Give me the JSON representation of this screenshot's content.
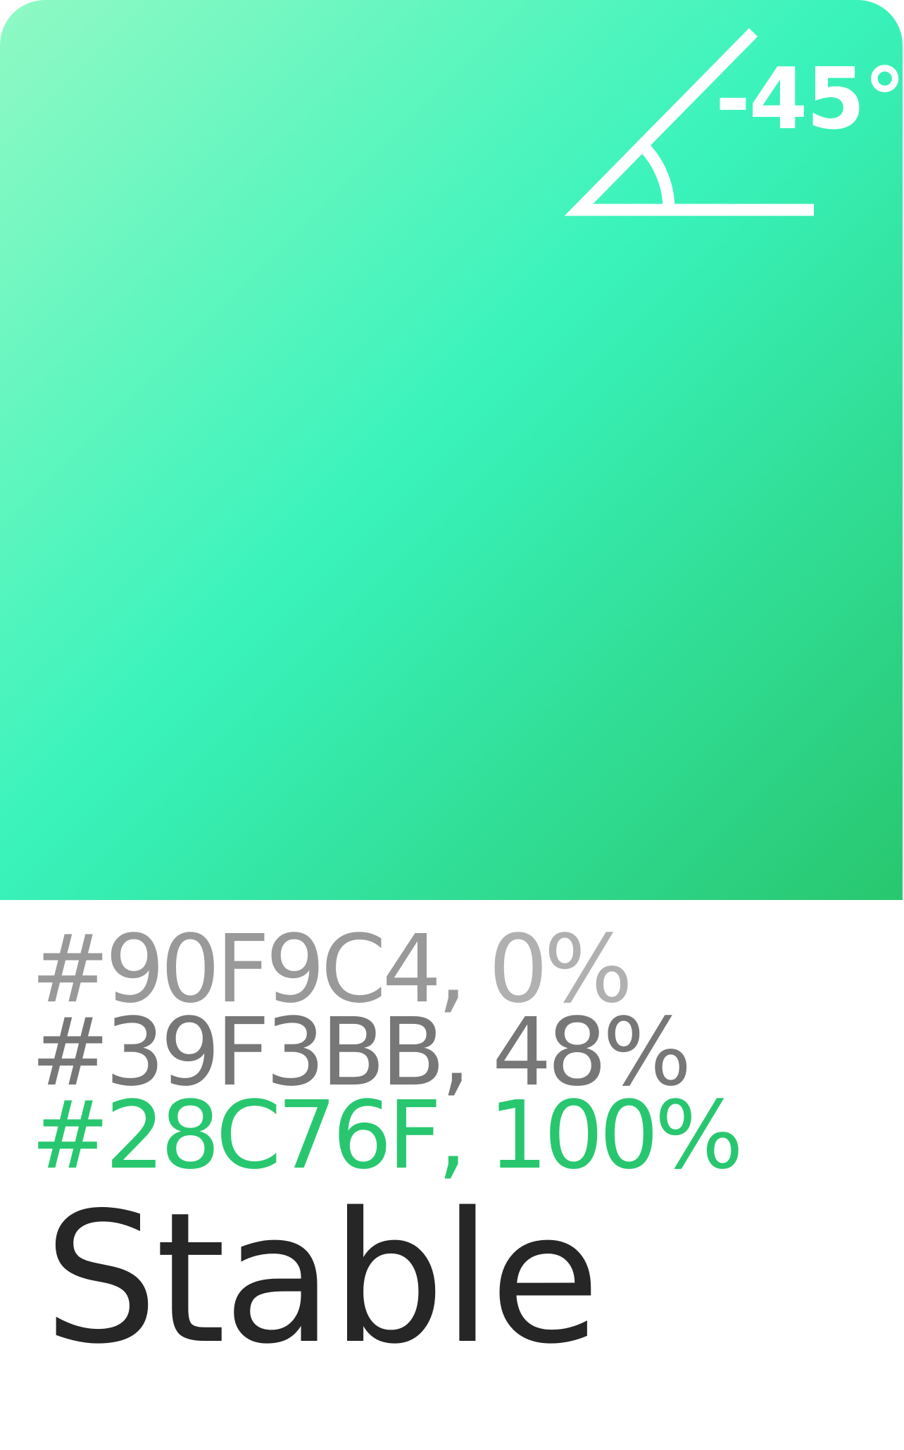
{
  "gradient": {
    "angle_label": "-45°",
    "angle_deg": -45,
    "stops": [
      {
        "hex": "#90F9C4",
        "position": "0%",
        "position_value": 0,
        "hex_text_color": "#999999",
        "pos_text_color": "#b0b0b0"
      },
      {
        "hex": "#39F3BB",
        "position": "48%",
        "position_value": 48,
        "hex_text_color": "#777777",
        "pos_text_color": "#777777"
      },
      {
        "hex": "#28C76F",
        "position": "100%",
        "position_value": 100,
        "hex_text_color": "#28C76F",
        "pos_text_color": "#28C76F"
      }
    ],
    "name": "Stable"
  },
  "colors": {
    "icon": "#ffffff",
    "name_text": "#262626",
    "background": "#ffffff"
  },
  "icons": {
    "angle": "angle-icon"
  }
}
